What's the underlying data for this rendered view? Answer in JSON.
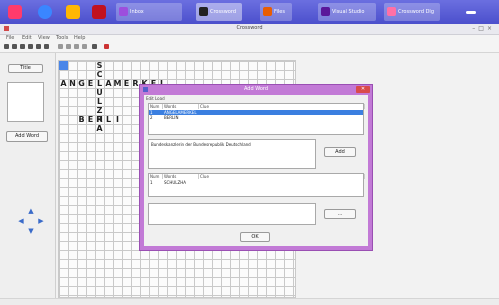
{
  "taskbar": {
    "tasks": [
      {
        "label": "Inbox"
      },
      {
        "label": "Crossword"
      },
      {
        "label": "Files"
      },
      {
        "label": "Visual Studio"
      },
      {
        "label": "Crossword Dlg"
      }
    ]
  },
  "window": {
    "title": "Crossword"
  },
  "menubar": {
    "items": [
      "File",
      "Edit",
      "View",
      "Tools",
      "Help"
    ]
  },
  "left_panel": {
    "title_label": "Title",
    "add_word_button": "Add Word"
  },
  "crossword": {
    "across_word_1": [
      "A",
      "N",
      "G",
      "E",
      "L",
      "A",
      "M",
      "E",
      "R",
      "K",
      "E",
      "L"
    ],
    "across_word_2": [
      "B",
      "E",
      "R",
      "L",
      "I"
    ],
    "down_word": [
      "B",
      "E",
      "R",
      "L",
      "I",
      "N"
    ],
    "down_extra": [
      "S",
      "C",
      "H",
      "U",
      "L",
      "Z",
      "H",
      "A"
    ]
  },
  "dialog": {
    "title": "Add Word",
    "menu": "Edit  Load",
    "table1": {
      "headers": [
        "Num",
        "Words",
        "Clue"
      ],
      "rows": [
        {
          "num": "1",
          "word": "ANGELAMERKEL",
          "clue": "",
          "selected": true
        },
        {
          "num": "2",
          "word": "BERLIN",
          "clue": "",
          "selected": false
        }
      ]
    },
    "clue_text": "Bundeskanzlerin der Bundesrepublik Deutschland",
    "add_button": "Add",
    "table2": {
      "headers": [
        "Num",
        "Words",
        "Clue"
      ],
      "rows": [
        {
          "num": "1",
          "word": "SCHULZHA",
          "clue": ""
        }
      ]
    },
    "ok_button": "OK",
    "small_button": "..."
  }
}
